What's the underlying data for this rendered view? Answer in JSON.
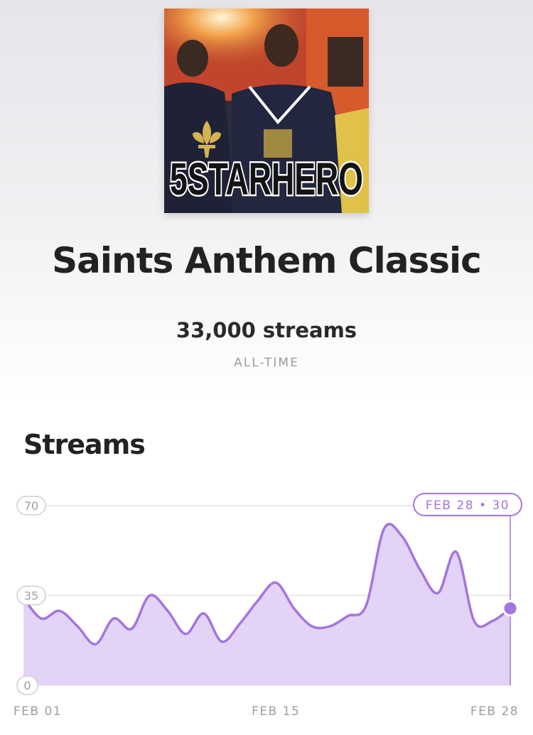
{
  "song": {
    "cover_text": "5STARHERO",
    "title": "Saints Anthem Classic",
    "streams": "33,000 streams",
    "period": "ALL-TIME"
  },
  "section": {
    "title": "Streams"
  },
  "colors": {
    "accent": "#a475de",
    "fill": "#e3d3f7",
    "grid": "#e4e4e4",
    "axis_text": "#9e9e9e"
  },
  "chart_data": {
    "type": "area",
    "x": [
      "Feb 01",
      "Feb 02",
      "Feb 03",
      "Feb 04",
      "Feb 05",
      "Feb 06",
      "Feb 07",
      "Feb 08",
      "Feb 09",
      "Feb 10",
      "Feb 11",
      "Feb 12",
      "Feb 13",
      "Feb 14",
      "Feb 15",
      "Feb 16",
      "Feb 17",
      "Feb 18",
      "Feb 19",
      "Feb 20",
      "Feb 21",
      "Feb 22",
      "Feb 23",
      "Feb 24",
      "Feb 25",
      "Feb 26",
      "Feb 27",
      "Feb 28"
    ],
    "values": [
      34,
      26,
      29,
      23,
      16,
      26,
      22,
      35,
      29,
      20,
      28,
      17,
      24,
      33,
      40,
      30,
      23,
      23,
      27,
      31,
      61,
      58,
      45,
      36,
      52,
      25,
      25,
      30
    ],
    "ylim": [
      0,
      70
    ],
    "yticks": [
      "0",
      "35",
      "70"
    ],
    "xticks": [
      "FEB 01",
      "FEB 15",
      "FEB 28"
    ],
    "tooltip": "FEB 28 • 30",
    "title": "Streams",
    "grid": true
  }
}
